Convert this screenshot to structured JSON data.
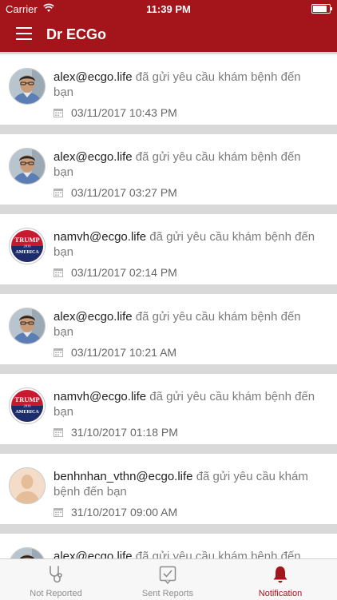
{
  "status_bar": {
    "carrier": "Carrier",
    "time": "11:39 PM",
    "battery_level": 0.95
  },
  "header": {
    "title": "Dr ECGo"
  },
  "notifications": [
    {
      "avatar": "man-photo",
      "email": "alex@ecgo.life",
      "message": " đã gửi yêu cầu khám bệnh đến bạn",
      "time": "03/11/2017 10:43 PM"
    },
    {
      "avatar": "man-photo",
      "email": "alex@ecgo.life",
      "message": " đã gửi yêu cầu khám bệnh đến bạn",
      "time": "03/11/2017 03:27 PM"
    },
    {
      "avatar": "trump-badge",
      "email": "namvh@ecgo.life",
      "message": " đã gửi yêu cầu khám bệnh đến bạn",
      "time": "03/11/2017 02:14 PM"
    },
    {
      "avatar": "man-photo",
      "email": "alex@ecgo.life",
      "message": " đã gửi yêu cầu khám bệnh đến bạn",
      "time": "03/11/2017 10:21 AM"
    },
    {
      "avatar": "trump-badge",
      "email": "namvh@ecgo.life",
      "message": " đã gửi yêu cầu khám bệnh đến bạn",
      "time": "31/10/2017 01:18 PM"
    },
    {
      "avatar": "default-person",
      "email": "benhnhan_vthn@ecgo.life",
      "message": " đã gửi yêu cầu khám bệnh đến bạn",
      "time": "31/10/2017 09:00 AM"
    },
    {
      "avatar": "man-photo",
      "email": "alex@ecgo.life",
      "message": " đã gửi yêu cầu khám bệnh đến bạn",
      "time": ""
    }
  ],
  "badge_text": {
    "line1": "TRUMP",
    "line2": "2016",
    "line3": "AMERICA"
  },
  "tabs": [
    {
      "label": "Not Reported",
      "icon": "stethoscope-icon",
      "active": false
    },
    {
      "label": "Sent Reports",
      "icon": "checked-document-icon",
      "active": false
    },
    {
      "label": "Notification",
      "icon": "bell-icon",
      "active": true
    }
  ],
  "colors": {
    "brand": "#a3141b",
    "inactive_tab": "#8e8e8e",
    "separator": "#d9d9d9"
  }
}
